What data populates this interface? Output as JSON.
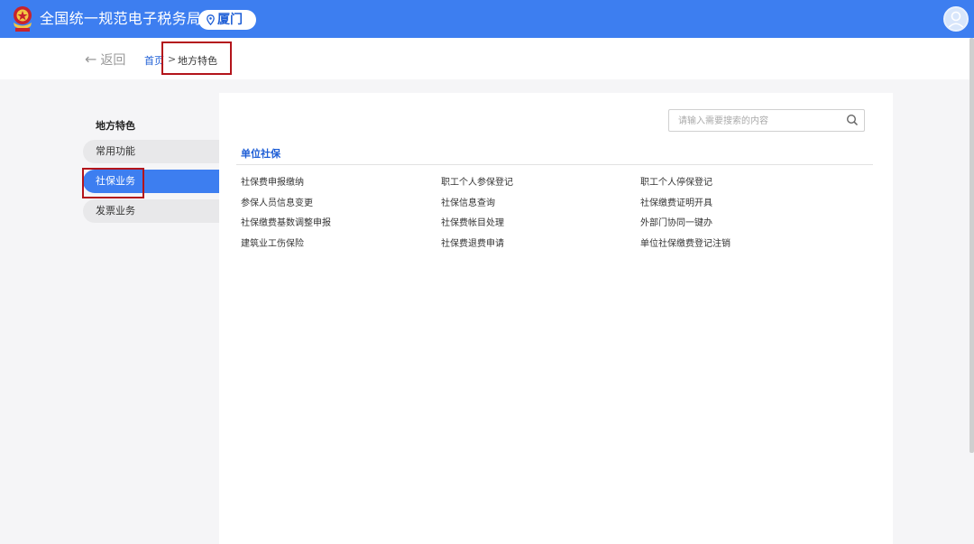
{
  "header": {
    "site_title": "全国统一规范电子税务局",
    "city": "厦门",
    "icons": [
      "tax-emblem-icon",
      "location-pin-icon",
      "user-avatar-icon"
    ],
    "brand_color": "#3d7ef0"
  },
  "breadcrumb": {
    "back_label": "返回",
    "home": "首页",
    "separator": ">",
    "current": "地方特色"
  },
  "sidebar": {
    "title": "地方特色",
    "items": [
      {
        "label": "常用功能",
        "active": false
      },
      {
        "label": "社保业务",
        "active": true
      },
      {
        "label": "发票业务",
        "active": false
      }
    ]
  },
  "content": {
    "search_placeholder": "请输入需要搜索的内容",
    "section_title": "单位社保",
    "links": [
      [
        "社保费申报缴纳",
        "职工个人参保登记",
        "职工个人停保登记"
      ],
      [
        "参保人员信息变更",
        "社保信息查询",
        "社保缴费证明开具"
      ],
      [
        "社保缴费基数调整申报",
        "社保费帐目处理",
        "外部门协同一键办"
      ],
      [
        "建筑业工伤保险",
        "社保费退费申请",
        "单位社保缴费登记注销"
      ]
    ]
  }
}
